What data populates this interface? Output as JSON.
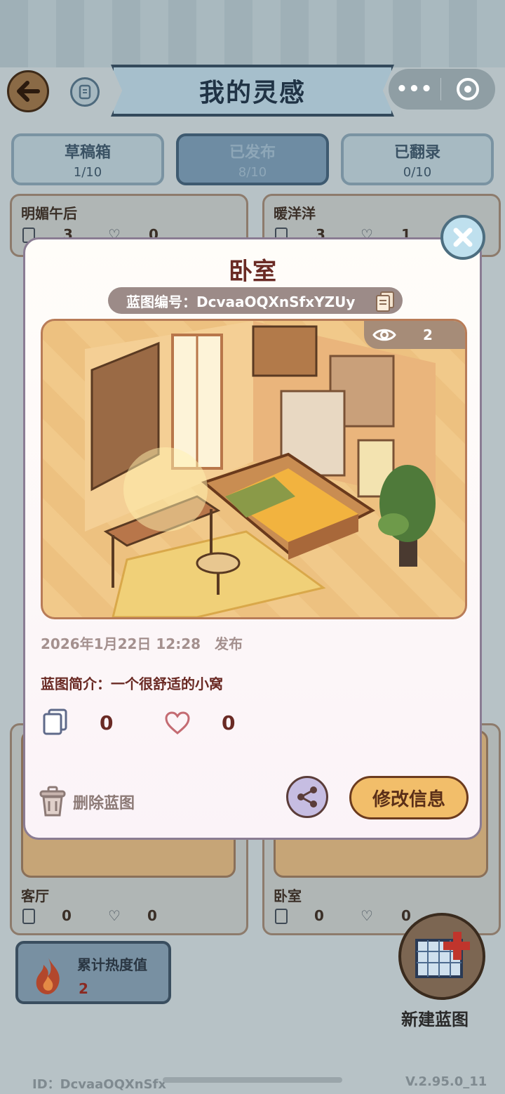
{
  "header": {
    "title": "我的灵感",
    "more_label": "•••"
  },
  "tabs": [
    {
      "label": "草稿箱",
      "count": "1/10"
    },
    {
      "label": "已发布",
      "count": "8/10"
    },
    {
      "label": "已翻录",
      "count": "0/10"
    }
  ],
  "cards": [
    {
      "name": "明媚午后",
      "copies": "3",
      "likes": "0"
    },
    {
      "name": "暖洋洋",
      "copies": "3",
      "likes": "1"
    },
    {
      "name": "客厅",
      "copies": "0",
      "likes": "0"
    },
    {
      "name": "卧室",
      "copies": "0",
      "likes": "0"
    }
  ],
  "heat": {
    "label": "累计热度值",
    "value": "2"
  },
  "new_blueprint_label": "新建蓝图",
  "footer": {
    "id": "ID：DcvaaOQXnSfx",
    "version": "V.2.95.0_11"
  },
  "modal": {
    "title": "卧室",
    "code_label": "蓝图编号：DcvaaOQXnSfxYZUy",
    "views": "2",
    "date": "2026年1月22日 12:28",
    "status": "发布",
    "intro": "蓝图简介：一个很舒适的小窝",
    "copies": "0",
    "likes": "0",
    "delete_label": "删除蓝图",
    "edit_label": "修改信息"
  },
  "colors": {
    "accent_button": "#f2be6a",
    "title_text": "#6a2a24",
    "active_tab": "#6e8ca3"
  }
}
